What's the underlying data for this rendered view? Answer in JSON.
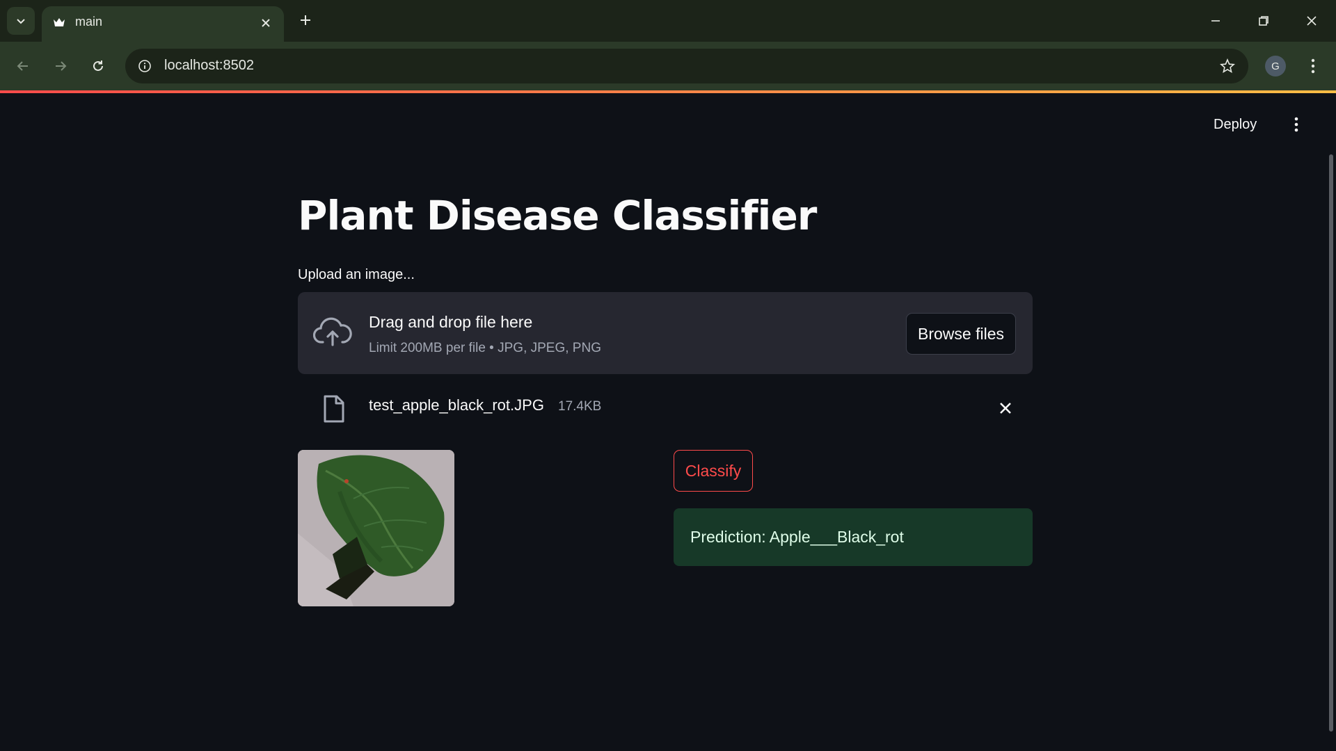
{
  "browser": {
    "tab_title": "main",
    "url": "localhost:8502",
    "profile_initial": "G"
  },
  "app": {
    "deploy_label": "Deploy",
    "title": "Plant Disease Classifier",
    "upload_label": "Upload an image...",
    "dropzone": {
      "title": "Drag and drop file here",
      "limit": "Limit 200MB per file • JPG, JPEG, PNG",
      "browse_label": "Browse files"
    },
    "file": {
      "name": "test_apple_black_rot.JPG",
      "size": "17.4KB"
    },
    "classify_label": "Classify",
    "prediction": "Prediction: Apple___Black_rot"
  },
  "colors": {
    "accent": "#ff4b4b",
    "background": "#0e1117",
    "success_bg": "#173928"
  },
  "icons": [
    "tab-search-icon",
    "favicon-icon",
    "close-icon",
    "plus-icon",
    "minimize-icon",
    "restore-icon",
    "window-close-icon",
    "back-icon",
    "forward-icon",
    "reload-icon",
    "info-icon",
    "star-icon",
    "more-vert-icon",
    "cloud-upload-icon",
    "file-icon"
  ]
}
